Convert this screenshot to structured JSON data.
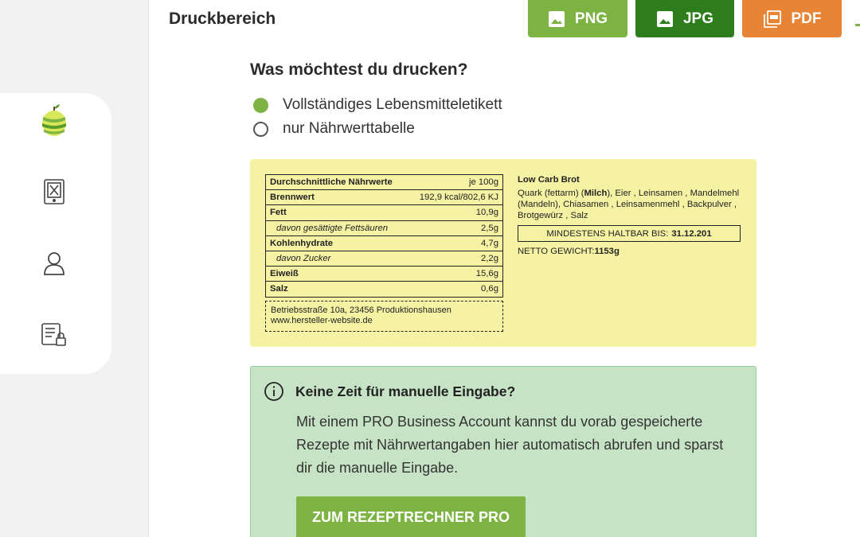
{
  "header": {
    "title": "Druckbereich",
    "export": {
      "png_label": "PNG",
      "jpg_label": "JPG",
      "pdf_label": "PDF"
    }
  },
  "print_options": {
    "question": "Was möchtest du drucken?",
    "options": [
      {
        "label": "Vollständiges Lebensmitteletikett",
        "selected": true
      },
      {
        "label": "nur Nährwerttabelle",
        "selected": false
      }
    ]
  },
  "label": {
    "nutrition": {
      "header_label": "Durchschnittliche Nährwerte",
      "header_unit": "je 100g",
      "rows": [
        {
          "name": "Brennwert",
          "value": "192,9 kcal/802,6 KJ"
        },
        {
          "name": "Fett",
          "value": "10,9g"
        },
        {
          "name": "davon gesättigte Fettsäuren",
          "value": "2,5g"
        },
        {
          "name": "Kohlenhydrate",
          "value": "4,7g"
        },
        {
          "name": "davon Zucker",
          "value": "2,2g"
        },
        {
          "name": "Eiweiß",
          "value": "15,6g"
        },
        {
          "name": "Salz",
          "value": "0,6g"
        }
      ]
    },
    "address": {
      "line1": "Betriebsstraße 10a, 23456 Produktionshausen",
      "line2": "www.hersteller-website.de"
    },
    "recipe": {
      "title": "Low Carb Brot",
      "ing_a": "Quark (fettarm) (",
      "ing_allergen1": "Milch",
      "ing_b": "), Eier , Leinsamen , Mandelmehl (Mandeln), Chiasamen , Leinsamenmehl , Backpulver , Brotgewürz , Salz",
      "mhd_label": "MINDESTENS HALTBAR BIS:",
      "mhd_date": "31.12.201",
      "netto_label": "NETTO GEWICHT:",
      "netto_value": "1153g"
    }
  },
  "info": {
    "title": "Keine Zeit für manuelle Eingabe?",
    "text": "Mit einem PRO Business Account kannst du vorab gespeicherte Rezepte mit Nährwertangaben hier automatisch abrufen und sparst dir die manuelle Eingabe.",
    "button_label": "ZUM REZEPTRECHNER PRO"
  },
  "colors": {
    "png": "#7cb342",
    "jpg": "#2e7d1d",
    "pdf": "#e88435",
    "label_bg": "#f6f2a4",
    "info_bg": "#c6e4c5"
  },
  "sidebar": {
    "icons": [
      "apple-logo-icon",
      "recipe-tablet-icon",
      "user-icon",
      "checklist-lock-icon"
    ]
  }
}
